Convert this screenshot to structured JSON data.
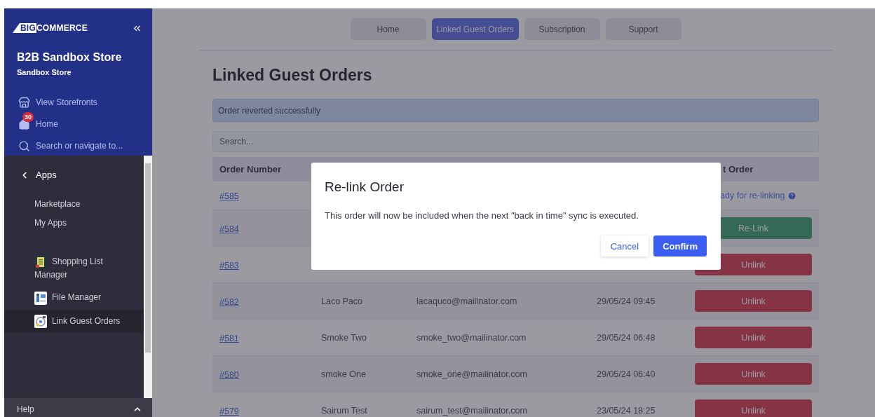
{
  "sidebar": {
    "logo_mark": "BIG",
    "logo_word": "COMMERCE",
    "store_name": "B2B Sandbox Store",
    "store_subtitle": "Sandbox Store",
    "top_items": [
      {
        "kind": "store",
        "label": "View Storefronts"
      },
      {
        "kind": "home",
        "label": "Home",
        "badge": "30"
      },
      {
        "kind": "search",
        "label": "Search or navigate to..."
      }
    ],
    "section": "Apps",
    "links": [
      {
        "label": "Marketplace"
      },
      {
        "label": "My Apps"
      }
    ],
    "apps": [
      {
        "kind": "list",
        "label": "Shopping List Manager",
        "selected": false
      },
      {
        "kind": "file",
        "label": "File Manager",
        "selected": false
      },
      {
        "kind": "link",
        "label": "Link Guest Orders",
        "selected": true
      }
    ],
    "help": "Help"
  },
  "nav_tabs": [
    {
      "label": "Home",
      "selected": false
    },
    {
      "label": "Linked Guest Orders",
      "selected": true
    },
    {
      "label": "Subscription",
      "selected": false
    },
    {
      "label": "Support",
      "selected": false
    }
  ],
  "page_title": "Linked Guest Orders",
  "alert": "Order reverted successfully",
  "search": {
    "placeholder": "Search..."
  },
  "table": {
    "header": {
      "order_number": "Order Number",
      "column_5": "t Order"
    },
    "rows": [
      {
        "order": "#585",
        "action": {
          "kind": "status",
          "text": "ady for re-linking"
        }
      },
      {
        "order": "#584",
        "action": {
          "kind": "relink",
          "text": "Re-Link"
        }
      },
      {
        "order": "#583",
        "action": {
          "kind": "unlink",
          "text": "Unlink"
        }
      },
      {
        "order": "#582",
        "name": "Laco Paco",
        "email": "lacaquco@mailinator.com",
        "date": "29/05/24 09:45",
        "action": {
          "kind": "unlink",
          "text": "Unlink"
        }
      },
      {
        "order": "#581",
        "name": "Smoke Two",
        "email": "smoke_two@mailinator.com",
        "date": "29/05/24 06:48",
        "action": {
          "kind": "unlink",
          "text": "Unlink"
        }
      },
      {
        "order": "#580",
        "name": "smoke One",
        "email": "smoke_one@mailinator.com",
        "date": "29/05/24 06:40",
        "action": {
          "kind": "unlink",
          "text": "Unlink"
        }
      },
      {
        "order": "#579",
        "name": "Sairum Test",
        "email": "sairum_test@mailinator.com",
        "date": "23/05/24 18:25",
        "action": {
          "kind": "unlink",
          "text": "Unlink"
        }
      }
    ]
  },
  "modal": {
    "title": "Re-link Order",
    "message": "This order will now be included when the next \"back in time\" sync is executed.",
    "buttons": [
      {
        "kind": "secondary",
        "label": "Cancel"
      },
      {
        "kind": "primary",
        "label": "Confirm"
      }
    ]
  }
}
